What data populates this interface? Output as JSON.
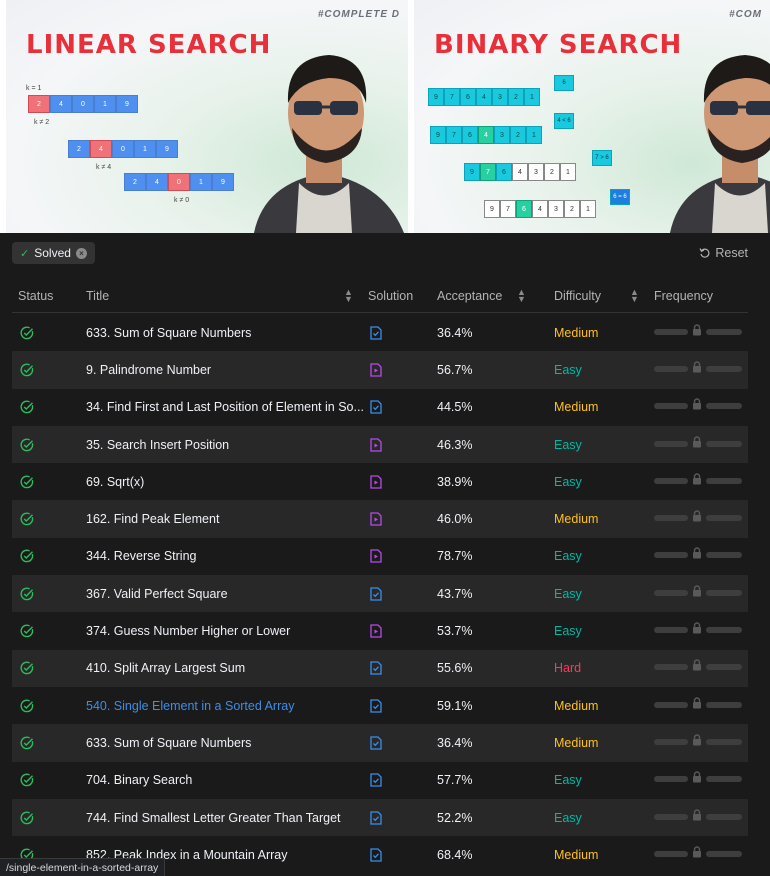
{
  "thumbnails": {
    "left": {
      "tag": "#COMPLETE D",
      "headline": "LINEAR SEARCH",
      "rows": [
        {
          "cells": [
            "2",
            "4",
            "0",
            "1",
            "9"
          ],
          "hl": 0,
          "above": "k = 1",
          "below": "k ≠ 2"
        },
        {
          "cells": [
            "2",
            "4",
            "0",
            "1",
            "9"
          ],
          "hl": 1,
          "below": "k ≠ 4"
        },
        {
          "cells": [
            "2",
            "4",
            "0",
            "1",
            "9"
          ],
          "hl": 2,
          "below": "k ≠ 0"
        }
      ]
    },
    "right": {
      "tag": "#COM",
      "headline": "BINARY SEARCH",
      "row1": [
        "9",
        "7",
        "6",
        "4",
        "3",
        "2",
        "1"
      ],
      "row2": [
        "9",
        "7",
        "6",
        "4",
        "3",
        "2",
        "1"
      ],
      "row3": [
        "9",
        "7",
        "6",
        "4",
        "3",
        "2",
        "1"
      ],
      "row4": [
        "9",
        "7",
        "6",
        "4",
        "3",
        "2",
        "1"
      ],
      "labels": [
        "6",
        "4 < 6",
        "7 > 6",
        "6 = 6"
      ]
    }
  },
  "filter": {
    "chip_label": "Solved",
    "reset_label": "Reset"
  },
  "columns": {
    "status": "Status",
    "title": "Title",
    "solution": "Solution",
    "acceptance": "Acceptance",
    "difficulty": "Difficulty",
    "frequency": "Frequency"
  },
  "problems": [
    {
      "title": "633. Sum of Square Numbers",
      "solution": "article",
      "acceptance": "36.4%",
      "difficulty": "Medium"
    },
    {
      "title": "9. Palindrome Number",
      "solution": "video",
      "acceptance": "56.7%",
      "difficulty": "Easy"
    },
    {
      "title": "34. Find First and Last Position of Element in So...",
      "solution": "article",
      "acceptance": "44.5%",
      "difficulty": "Medium"
    },
    {
      "title": "35. Search Insert Position",
      "solution": "video",
      "acceptance": "46.3%",
      "difficulty": "Easy"
    },
    {
      "title": "69. Sqrt(x)",
      "solution": "video",
      "acceptance": "38.9%",
      "difficulty": "Easy"
    },
    {
      "title": "162. Find Peak Element",
      "solution": "video",
      "acceptance": "46.0%",
      "difficulty": "Medium"
    },
    {
      "title": "344. Reverse String",
      "solution": "video",
      "acceptance": "78.7%",
      "difficulty": "Easy"
    },
    {
      "title": "367. Valid Perfect Square",
      "solution": "article",
      "acceptance": "43.7%",
      "difficulty": "Easy"
    },
    {
      "title": "374. Guess Number Higher or Lower",
      "solution": "video",
      "acceptance": "53.7%",
      "difficulty": "Easy"
    },
    {
      "title": "410. Split Array Largest Sum",
      "solution": "article",
      "acceptance": "55.6%",
      "difficulty": "Hard"
    },
    {
      "title": "540. Single Element in a Sorted Array",
      "solution": "article",
      "acceptance": "59.1%",
      "difficulty": "Medium",
      "hovered": true
    },
    {
      "title": "633. Sum of Square Numbers",
      "solution": "article",
      "acceptance": "36.4%",
      "difficulty": "Medium"
    },
    {
      "title": "704. Binary Search",
      "solution": "article",
      "acceptance": "57.7%",
      "difficulty": "Easy"
    },
    {
      "title": "744. Find Smallest Letter Greater Than Target",
      "solution": "article",
      "acceptance": "52.2%",
      "difficulty": "Easy"
    },
    {
      "title": "852. Peak Index in a Mountain Array",
      "solution": "article",
      "acceptance": "68.4%",
      "difficulty": "Medium"
    }
  ],
  "colors": {
    "solved": "#2cbb5d",
    "easy": "#00b8a3",
    "medium": "#ffc01e",
    "hard": "#ff375f",
    "link": "#3b8eea",
    "article_icon": "#3b8eea",
    "video_icon": "#b64ce8"
  },
  "icons": {
    "status": "check-circle-icon",
    "article": "article-icon",
    "video": "video-icon",
    "lock": "lock-icon",
    "reset": "rotate-ccw-icon"
  },
  "status_url": "/single-element-in-a-sorted-array"
}
